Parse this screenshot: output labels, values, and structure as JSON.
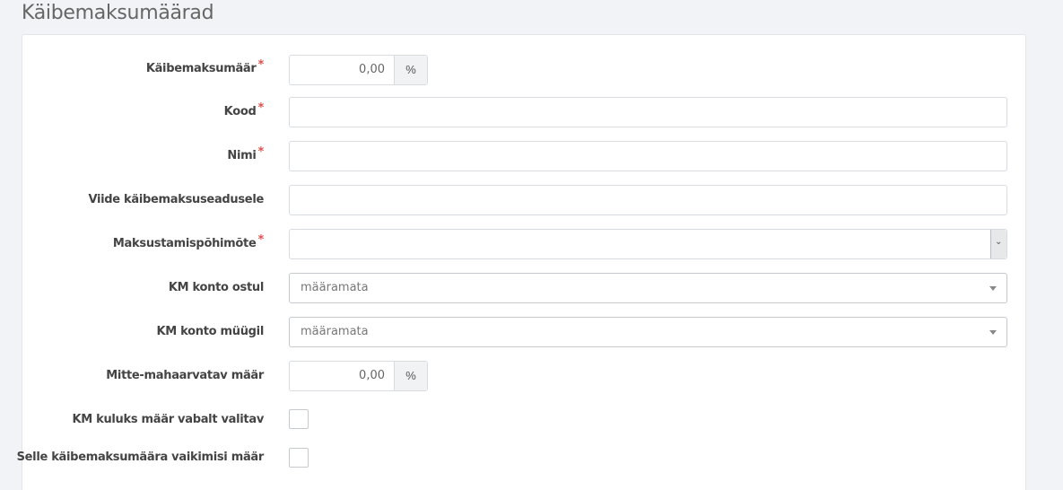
{
  "page": {
    "title": "Käibemaksumäärad"
  },
  "form": {
    "rate": {
      "label": "Käibemaksumäär",
      "required_mark": "*",
      "value": "0,00",
      "unit": "%"
    },
    "code": {
      "label": "Kood",
      "required_mark": "*",
      "value": ""
    },
    "name": {
      "label": "Nimi",
      "required_mark": "*",
      "value": ""
    },
    "law_reference": {
      "label": "Viide käibemaksuseadusele",
      "value": ""
    },
    "taxation_principle": {
      "label": "Maksustamispõhimõte",
      "required_mark": "*",
      "value": ""
    },
    "vat_account_purchase": {
      "label": "KM konto ostul",
      "value": "määramata"
    },
    "vat_account_sale": {
      "label": "KM konto müügil",
      "value": "määramata"
    },
    "non_deductible_rate": {
      "label": "Mitte-mahaarvatav määr",
      "value": "0,00",
      "unit": "%"
    },
    "expense_rate_free_choice": {
      "label": "KM kuluks määr vabalt valitav",
      "checked": false
    },
    "default_rate": {
      "label": "Selle käibemaksumäära vaikimisi määr",
      "checked": false
    }
  }
}
